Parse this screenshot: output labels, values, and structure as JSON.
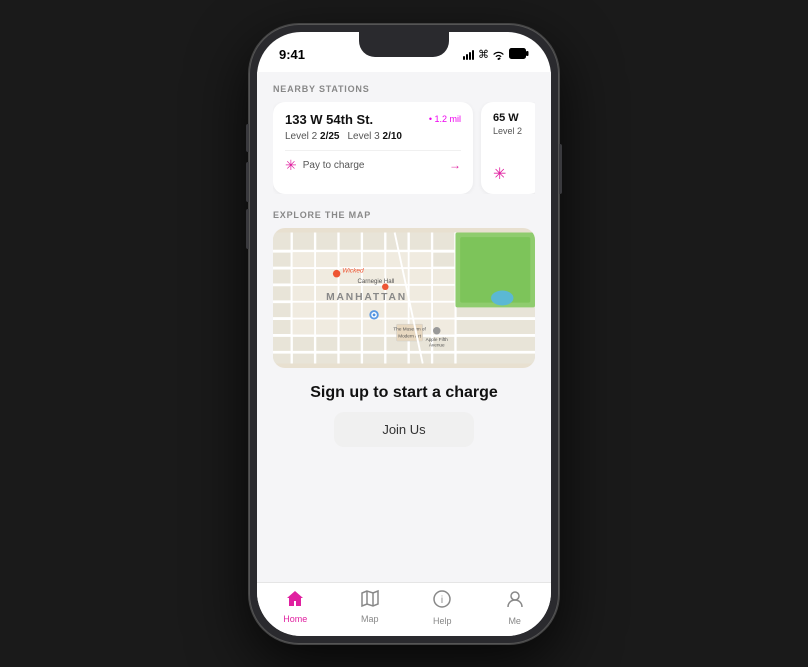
{
  "statusBar": {
    "time": "9:41",
    "icons": [
      "signal",
      "wifi",
      "battery"
    ]
  },
  "nearby": {
    "sectionLabel": "NEARBY STATIONS",
    "stations": [
      {
        "address": "133 W 54th St.",
        "distance": "• 1.2 mil",
        "levels": [
          {
            "label": "Level 2",
            "count": "2/25"
          },
          {
            "label": "Level 3",
            "count": "2/10"
          }
        ],
        "action": "Pay to charge"
      },
      {
        "address": "65 W",
        "distance": "",
        "levels": [
          {
            "label": "Level 2",
            "count": ""
          }
        ],
        "action": ""
      }
    ]
  },
  "map": {
    "sectionLabel": "EXPLORE THE MAP",
    "location": "MANHATTAN"
  },
  "signup": {
    "title": "Sign up to start a charge",
    "buttonLabel": "Join Us"
  },
  "tabs": [
    {
      "id": "home",
      "label": "Home",
      "active": true
    },
    {
      "id": "map",
      "label": "Map",
      "active": false
    },
    {
      "id": "help",
      "label": "Help",
      "active": false
    },
    {
      "id": "me",
      "label": "Me",
      "active": false
    }
  ]
}
